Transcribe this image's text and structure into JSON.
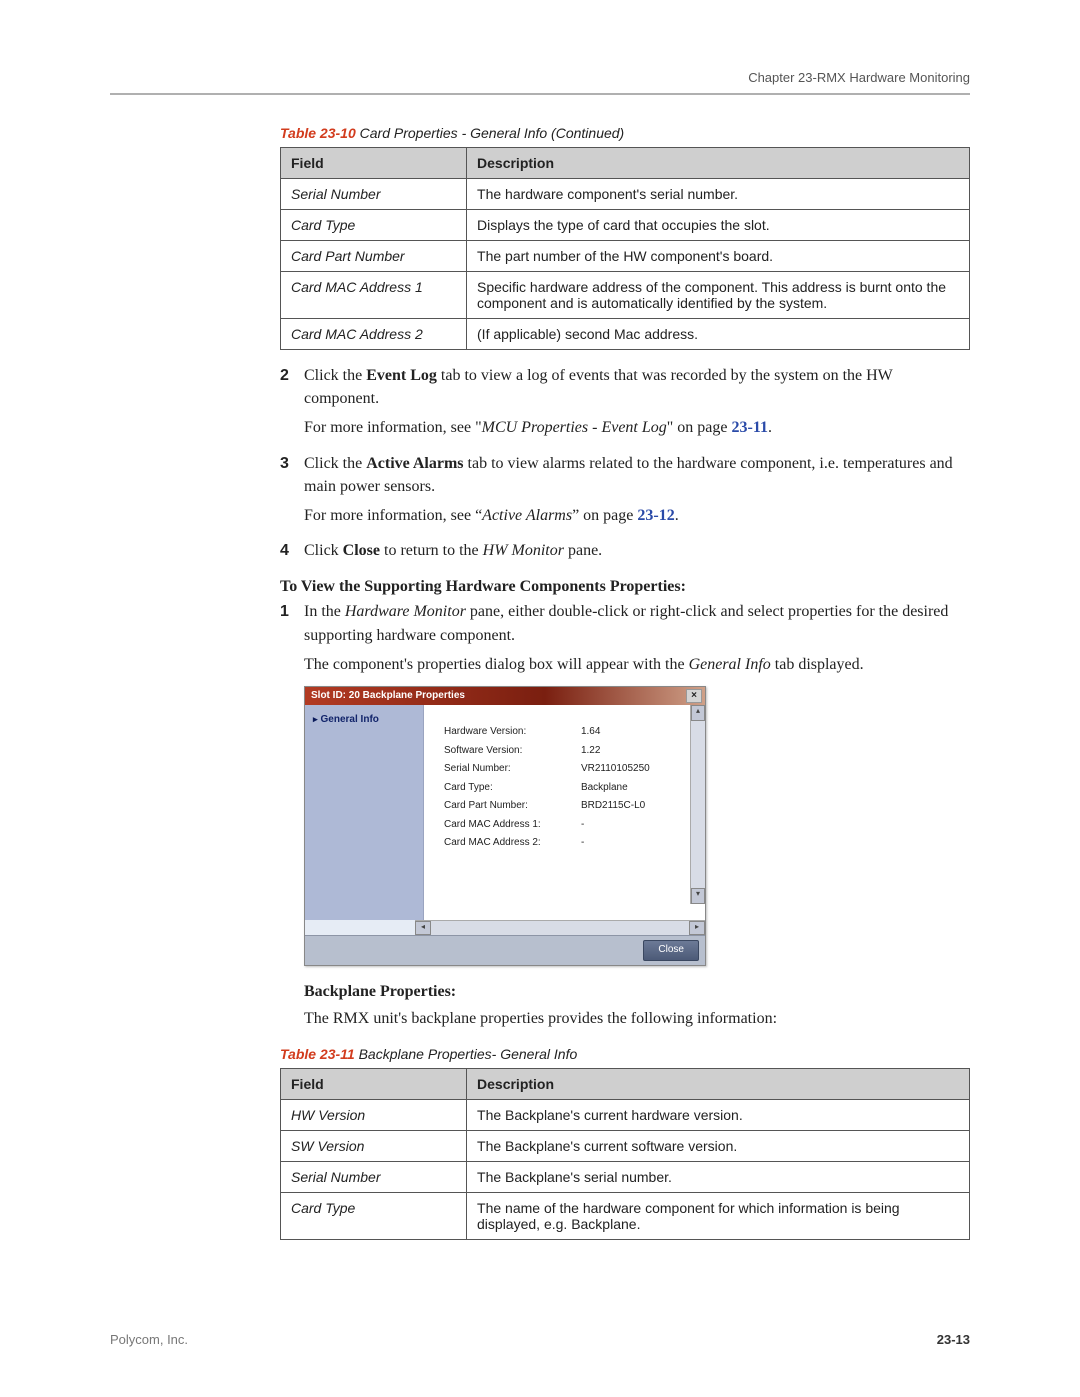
{
  "header": {
    "chapter": "Chapter 23-RMX Hardware Monitoring"
  },
  "table10": {
    "caption_num": "Table 23-10",
    "caption_rest": " Card Properties - General Info (Continued)",
    "headers": {
      "field": "Field",
      "desc": "Description"
    },
    "rows": [
      {
        "field": "Serial Number",
        "desc": "The hardware component's serial number."
      },
      {
        "field": "Card Type",
        "desc": "Displays the type of card that occupies the slot."
      },
      {
        "field": "Card Part Number",
        "desc": "The part number of the HW component's board."
      },
      {
        "field": "Card MAC Address 1",
        "desc": "Specific hardware address of the component. This address is burnt onto the component and is automatically identified by the system."
      },
      {
        "field": "Card MAC Address 2",
        "desc": "(If applicable) second Mac address."
      }
    ]
  },
  "steps_a": {
    "s2": {
      "num": "2",
      "pre": "Click the ",
      "bold": "Event Log",
      "post": " tab to view a log of events that was recorded by the system on the HW component.",
      "more_pre": "For more information, see \"",
      "more_i": "MCU Properties - Event Log",
      "more_mid": "\" on page ",
      "more_link": "23-11",
      "more_end": "."
    },
    "s3": {
      "num": "3",
      "pre": "Click the ",
      "bold": "Active Alarms",
      "post": " tab to view alarms related to the hardware component, i.e. temperatures and main power sensors.",
      "more_pre": "For more information, see “",
      "more_i": "Active Alarms",
      "more_mid": "” on page ",
      "more_link": "23-12",
      "more_end": "."
    },
    "s4": {
      "num": "4",
      "pre": "Click ",
      "bold": "Close",
      "post_pre": " to return to the ",
      "post_i": "HW Monitor",
      "post_end": " pane."
    }
  },
  "subhead1": "To View the Supporting Hardware Components Properties:",
  "steps_b": {
    "s1": {
      "num": "1",
      "pre": "In the ",
      "i1": "Hardware Monitor",
      "post": " pane, either double-click or right-click and select properties for the desired supporting hardware component.",
      "line2_pre": "The component's properties dialog box will appear with the ",
      "line2_i": "General Info",
      "line2_post": " tab displayed."
    }
  },
  "dialog": {
    "title": "Slot ID: 20   Backplane Properties",
    "sidebar_item": "General Info",
    "close_btn": "Close",
    "rows": [
      {
        "label": "Hardware Version:",
        "value": "1.64"
      },
      {
        "label": "Software Version:",
        "value": "1.22"
      },
      {
        "label": "Serial Number:",
        "value": "VR2110105250"
      },
      {
        "label": "Card Type:",
        "value": "Backplane"
      },
      {
        "label": "Card Part Number:",
        "value": "BRD2115C-L0"
      },
      {
        "label": "Card MAC Address 1:",
        "value": "-"
      },
      {
        "label": "Card MAC Address 2:",
        "value": "-"
      }
    ]
  },
  "subhead2": "Backplane Properties:",
  "backplane_intro": "The RMX unit's backplane properties provides the following information:",
  "table11": {
    "caption_num": "Table 23-11",
    "caption_rest": " Backplane Properties- General Info",
    "headers": {
      "field": "Field",
      "desc": "Description"
    },
    "rows": [
      {
        "field": "HW Version",
        "desc": "The Backplane's current hardware version."
      },
      {
        "field": "SW Version",
        "desc": "The Backplane's current software version."
      },
      {
        "field": "Serial Number",
        "desc": "The Backplane's serial number."
      },
      {
        "field": "Card Type",
        "desc": "The name of the hardware component for which information is being displayed, e.g. Backplane."
      }
    ]
  },
  "footer": {
    "left": "Polycom, Inc.",
    "right": "23-13"
  }
}
